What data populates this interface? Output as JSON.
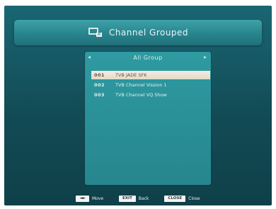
{
  "header": {
    "title": "Channel Grouped"
  },
  "panel": {
    "title": "All Group",
    "nav_left": "◂",
    "nav_right": "▸"
  },
  "list": {
    "rows": [
      {
        "num": "001",
        "name": "TVB JADE SFK"
      },
      {
        "num": "002",
        "name": "TVB Channel Vission 1"
      },
      {
        "num": "003",
        "name": "TVB Channel VQ Show"
      }
    ]
  },
  "footer": {
    "hints": [
      {
        "key": "◄►",
        "label": "Move"
      },
      {
        "key": "EXIT",
        "label": "Back"
      },
      {
        "key": "CLOSE",
        "label": "Close"
      }
    ]
  },
  "colors": {
    "screen_bg": "#124b55",
    "header_bg": "#2a8790",
    "panel_bg": "#2a8e96",
    "selected_row": "#e9e1cf"
  }
}
